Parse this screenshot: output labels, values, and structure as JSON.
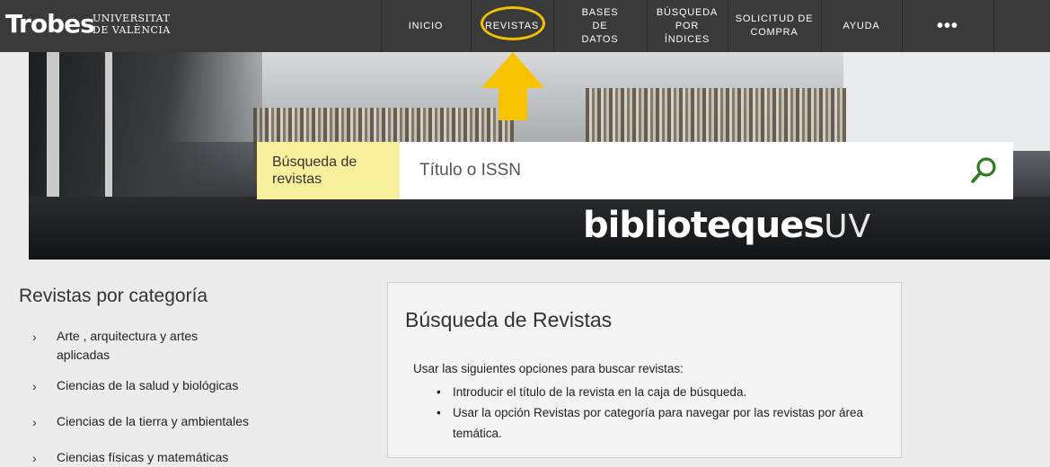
{
  "header": {
    "logo_trobes": "Trobes",
    "logo_university_line1": "UNIVERSITAT",
    "logo_university_line2": "DE VALÈNCIA",
    "nav": [
      {
        "label": "INICIO"
      },
      {
        "label": "REVISTAS"
      },
      {
        "label": "BASES DE DATOS"
      },
      {
        "label": "BÚSQUEDA POR ÍNDICES"
      },
      {
        "label": "SOLICITUD DE COMPRA"
      },
      {
        "label": "AYUDA"
      },
      {
        "label": "•••"
      }
    ]
  },
  "banner": {
    "brand_main": "biblioteques",
    "brand_suffix": "UV"
  },
  "search": {
    "label": "Búsqueda de revistas",
    "placeholder": "Título o ISSN",
    "button_icon": "search-icon"
  },
  "categories": {
    "title": "Revistas por categoría",
    "items": [
      {
        "label": "Arte , arquitectura y artes aplicadas"
      },
      {
        "label": "Ciencias de la salud y biológicas"
      },
      {
        "label": "Ciencias de la tierra y ambientales"
      },
      {
        "label": "Ciencias físicas y matemáticas"
      }
    ]
  },
  "info": {
    "title": "Búsqueda de Revistas",
    "intro": "Usar las siguientes opciones para buscar revistas:",
    "bullets": [
      "Introducir el título de la revista en la caja de búsqueda.",
      "Usar la opción Revistas por categoría para navegar por las revistas por área temática."
    ]
  },
  "colors": {
    "topbar": "#3a3a3a",
    "highlight": "#f2c200",
    "search_label_bg": "#f7ef9c",
    "search_icon": "#2e7d1e",
    "page_bg": "#ececec"
  }
}
